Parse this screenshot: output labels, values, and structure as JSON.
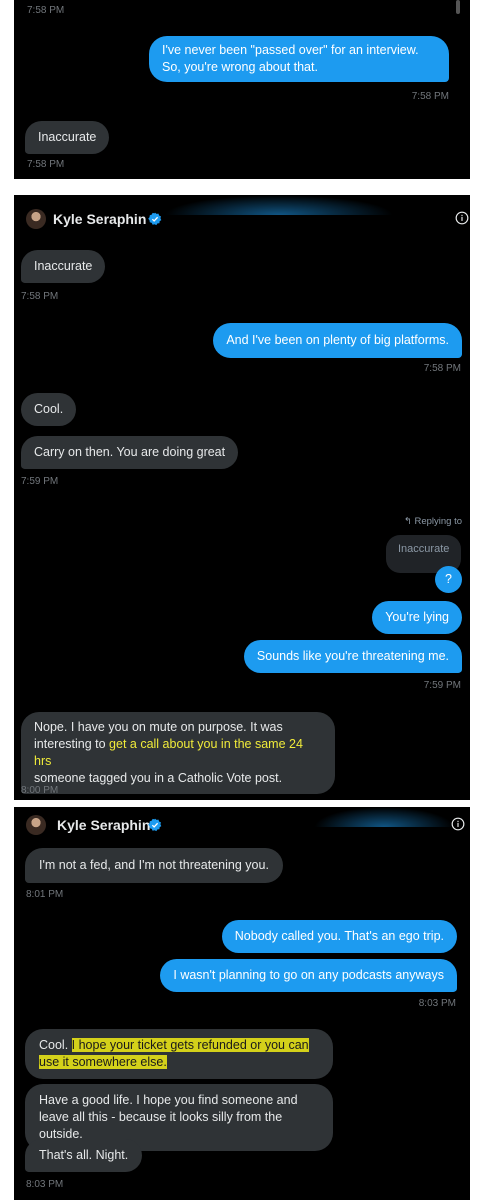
{
  "panel1": {
    "top_timestamp": "7:58 PM",
    "messages": [
      {
        "text": "I've never been \"passed over\" for an interview. So, you're wrong about that.",
        "time": "7:58 PM"
      },
      {
        "text": "Inaccurate",
        "time": "7:58 PM"
      }
    ]
  },
  "panel2": {
    "header": {
      "name": "Kyle Seraphin",
      "verified_icon": "verified-badge-icon",
      "info_icon": "info-icon"
    },
    "messages": [
      {
        "text": "Inaccurate",
        "time": "7:58 PM"
      },
      {
        "text": "And I've been on plenty of big platforms.",
        "time": "7:58 PM"
      },
      {
        "text": "Cool."
      },
      {
        "text": "Carry on then. You are doing great",
        "time": "7:59 PM"
      },
      {
        "replying_label": "Replying to",
        "quoted": "Inaccurate"
      },
      {
        "text": "?"
      },
      {
        "text": "You're lying"
      },
      {
        "text": "Sounds like you're threatening me.",
        "time": "7:59 PM"
      },
      {
        "text_part1": "Nope. I have you on mute on purpose. It was interesting to ",
        "text_highlight": "get a call about you in the same 24 hrs",
        "text_part2": "someone tagged you in a Catholic Vote post.",
        "time": "8:00 PM"
      }
    ]
  },
  "panel3": {
    "header": {
      "name": "Kyle Seraphin",
      "verified_icon": "verified-badge-icon",
      "info_icon": "info-icon"
    },
    "messages": [
      {
        "text": "I'm not a fed, and I'm not threatening you.",
        "time": "8:01 PM"
      },
      {
        "text": "Nobody called you. That's an ego trip."
      },
      {
        "text": "I wasn't planning to go on any podcasts anyways",
        "time": "8:03 PM"
      },
      {
        "text_prefix": "Cool. ",
        "text_highlight": "I hope your ticket gets refunded or you can use it somewhere else."
      },
      {
        "text": "Have a good life. I hope you find someone and leave all this - because it looks silly from the outside."
      },
      {
        "text": "That's all. Night.",
        "time": "8:03 PM"
      }
    ]
  },
  "colors": {
    "outgoing": "#1d9bf0",
    "incoming": "#2f3336",
    "background": "#000000",
    "highlight": "#d4d11a"
  }
}
